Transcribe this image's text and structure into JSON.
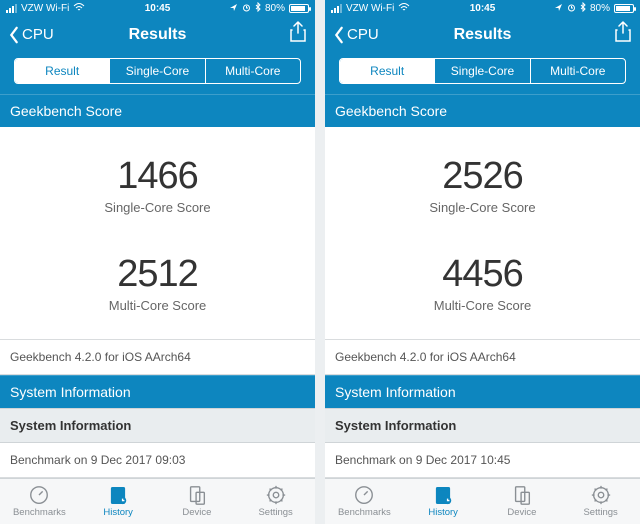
{
  "phones": [
    {
      "status": {
        "carrier": "VZW Wi-Fi",
        "time": "10:45",
        "battery_pct": "80%"
      },
      "nav": {
        "back": "CPU",
        "title": "Results"
      },
      "segments": {
        "result": "Result",
        "single": "Single-Core",
        "multi": "Multi-Core"
      },
      "section_score_header": "Geekbench Score",
      "scores": {
        "single_value": "1466",
        "single_label": "Single-Core Score",
        "multi_value": "2512",
        "multi_label": "Multi-Core Score"
      },
      "version": "Geekbench 4.2.0 for iOS AArch64",
      "sys_header": "System Information",
      "sys_subheader": "System Information",
      "benchmark_time": "Benchmark on 9 Dec 2017 09:03",
      "tabs": {
        "benchmarks": "Benchmarks",
        "history": "History",
        "device": "Device",
        "settings": "Settings"
      }
    },
    {
      "status": {
        "carrier": "VZW Wi-Fi",
        "time": "10:45",
        "battery_pct": "80%"
      },
      "nav": {
        "back": "CPU",
        "title": "Results"
      },
      "segments": {
        "result": "Result",
        "single": "Single-Core",
        "multi": "Multi-Core"
      },
      "section_score_header": "Geekbench Score",
      "scores": {
        "single_value": "2526",
        "single_label": "Single-Core Score",
        "multi_value": "4456",
        "multi_label": "Multi-Core Score"
      },
      "version": "Geekbench 4.2.0 for iOS AArch64",
      "sys_header": "System Information",
      "sys_subheader": "System Information",
      "benchmark_time": "Benchmark on 9 Dec 2017 10:45",
      "tabs": {
        "benchmarks": "Benchmarks",
        "history": "History",
        "device": "Device",
        "settings": "Settings"
      }
    }
  ]
}
